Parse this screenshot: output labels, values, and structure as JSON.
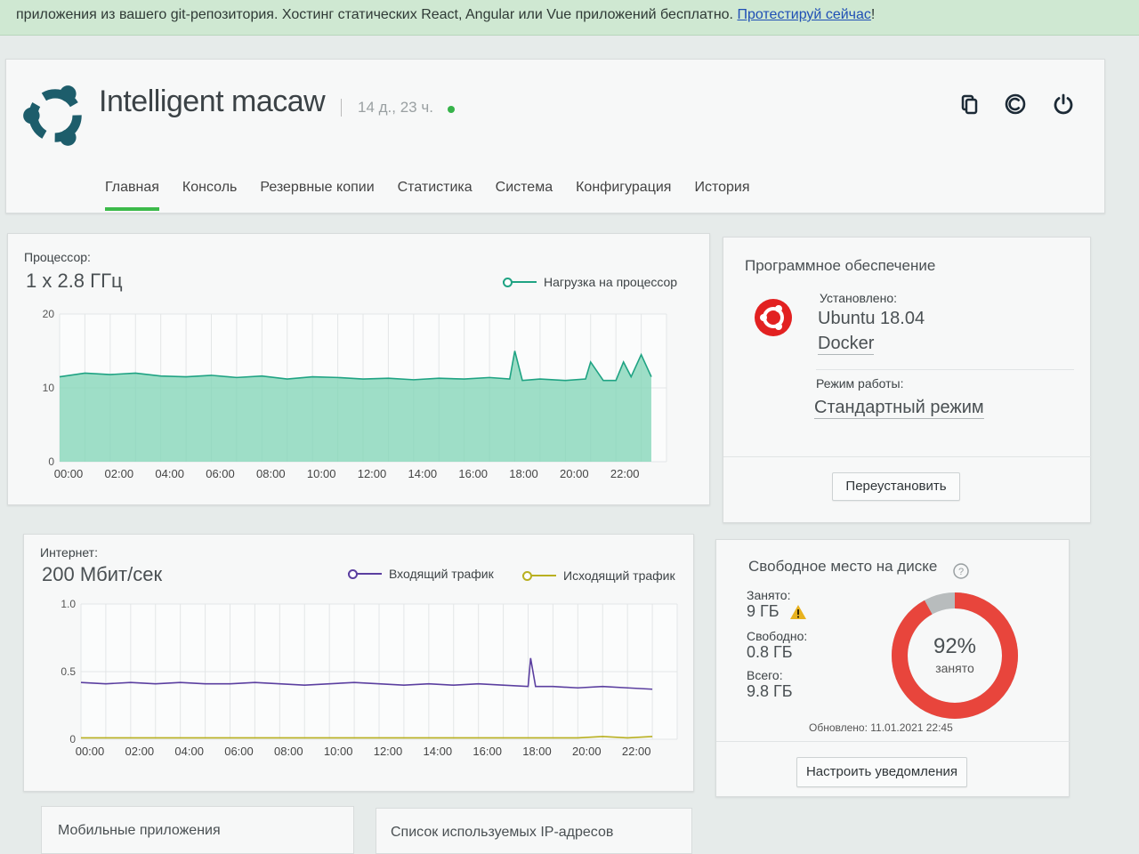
{
  "banner": {
    "text": "приложения из вашего git-репозитория. Хостинг статических React, Angular или Vue приложений бесплатно.",
    "link": "Протестируй сейчас",
    "tail": "!"
  },
  "server": {
    "name": "Intelligent macaw",
    "uptime": "14 д., 23 ч.",
    "status_color": "#36b34a"
  },
  "header_buttons": [
    "copy-icon",
    "reinstall-icon",
    "power-icon"
  ],
  "tabs": [
    {
      "label": "Главная",
      "active": true
    },
    {
      "label": "Консоль"
    },
    {
      "label": "Резервные копии"
    },
    {
      "label": "Статистика"
    },
    {
      "label": "Система"
    },
    {
      "label": "Конфигурация"
    },
    {
      "label": "История"
    }
  ],
  "cpu": {
    "label": "Процессор:",
    "value": "1 x 2.8 ГГц",
    "legend": "Нагрузка на процессор",
    "color": "#1fa383"
  },
  "network": {
    "label": "Интернет:",
    "value": "200 Мбит/сек",
    "legend_in": "Входящий трафик",
    "legend_out": "Исходящий трафик",
    "color_in": "#5b3fa0",
    "color_out": "#b9b021"
  },
  "software": {
    "title": "Программное обеспечение",
    "installed_label": "Установлено:",
    "os": "Ubuntu 18.04",
    "extra": "Docker",
    "mode_label": "Режим работы:",
    "mode": "Стандартный режим",
    "reinstall": "Переустановить"
  },
  "disk": {
    "title": "Свободное место на диске",
    "used_label": "Занято:",
    "used": "9 ГБ",
    "free_label": "Свободно:",
    "free": "0.8 ГБ",
    "total_label": "Всего:",
    "total": "9.8 ГБ",
    "percent": "92%",
    "percent_caption": "занято",
    "percent_value": 92,
    "updated": "Обновлено: 11.01.2021 22:45",
    "notify": "Настроить уведомления",
    "used_color": "#e8453c"
  },
  "bottom": {
    "mobile": "Мобильные приложения",
    "ips": "Список используемых IP-адресов"
  },
  "chart_data": [
    {
      "type": "area",
      "ylim": [
        0,
        20
      ],
      "yticks": [
        "0",
        "10",
        "20"
      ],
      "xticks": [
        "00:00",
        "02:00",
        "04:00",
        "06:00",
        "08:00",
        "10:00",
        "12:00",
        "14:00",
        "16:00",
        "18:00",
        "20:00",
        "22:00"
      ],
      "series": [
        {
          "name": "Нагрузка на процессор",
          "x": [
            0,
            1,
            2,
            3,
            4,
            5,
            6,
            7,
            8,
            9,
            10,
            11,
            12,
            13,
            14,
            15,
            16,
            17,
            17.8,
            18,
            18.3,
            19,
            20,
            20.8,
            21,
            21.5,
            22,
            22.3,
            22.6,
            23,
            23.4
          ],
          "values": [
            11.5,
            12,
            11.8,
            12,
            11.6,
            11.5,
            11.7,
            11.4,
            11.6,
            11.2,
            11.5,
            11.4,
            11.2,
            11.3,
            11.1,
            11.3,
            11.2,
            11.4,
            11.2,
            15,
            11,
            11.2,
            11,
            11.2,
            13.5,
            11,
            11,
            13.5,
            11.5,
            14.5,
            11.5
          ]
        }
      ]
    },
    {
      "type": "line",
      "ylim": [
        0,
        1.0
      ],
      "yticks": [
        "0",
        "0.5",
        "1.0"
      ],
      "xticks": [
        "00:00",
        "02:00",
        "04:00",
        "06:00",
        "08:00",
        "10:00",
        "12:00",
        "14:00",
        "16:00",
        "18:00",
        "20:00",
        "22:00"
      ],
      "series": [
        {
          "name": "Входящий трафик",
          "x": [
            0,
            1,
            2,
            3,
            4,
            5,
            6,
            7,
            8,
            9,
            10,
            11,
            12,
            13,
            14,
            15,
            16,
            17,
            18,
            18.1,
            18.3,
            19,
            20,
            21,
            22,
            23
          ],
          "values": [
            0.42,
            0.41,
            0.42,
            0.41,
            0.42,
            0.41,
            0.41,
            0.42,
            0.41,
            0.4,
            0.41,
            0.42,
            0.41,
            0.4,
            0.41,
            0.4,
            0.41,
            0.4,
            0.39,
            0.6,
            0.39,
            0.39,
            0.38,
            0.39,
            0.38,
            0.37
          ]
        },
        {
          "name": "Исходящий трафик",
          "x": [
            0,
            4,
            8,
            12,
            16,
            20,
            21,
            22,
            23
          ],
          "values": [
            0.01,
            0.01,
            0.01,
            0.01,
            0.01,
            0.01,
            0.02,
            0.01,
            0.02
          ]
        }
      ]
    }
  ]
}
